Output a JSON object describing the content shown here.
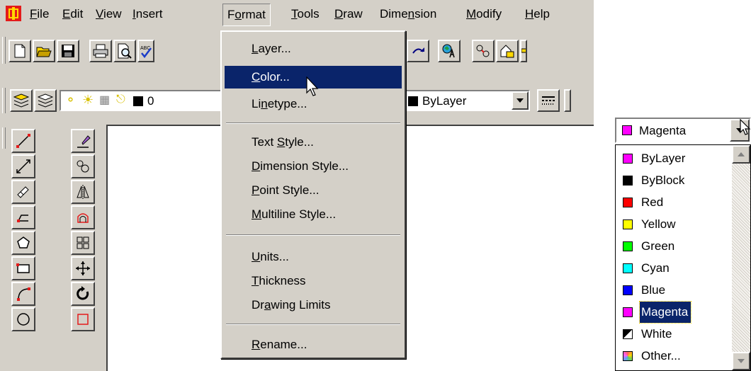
{
  "menubar": {
    "items": [
      {
        "pre": "",
        "key": "F",
        "post": "ile"
      },
      {
        "pre": "",
        "key": "E",
        "post": "dit"
      },
      {
        "pre": "",
        "key": "V",
        "post": "iew"
      },
      {
        "pre": "",
        "key": "I",
        "post": "nsert"
      },
      {
        "pre": "F",
        "key": "o",
        "post": "rmat"
      },
      {
        "pre": "",
        "key": "T",
        "post": "ools"
      },
      {
        "pre": "",
        "key": "D",
        "post": "raw"
      },
      {
        "pre": "Dime",
        "key": "n",
        "post": "sion"
      },
      {
        "pre": "",
        "key": "M",
        "post": "odify"
      },
      {
        "pre": "",
        "key": "H",
        "post": "elp"
      }
    ]
  },
  "layer_toolbar": {
    "layer_value": "0",
    "color_value": "ByLayer"
  },
  "format_menu": {
    "items": [
      {
        "pre": "",
        "key": "L",
        "post": "ayer..."
      },
      {
        "pre": "",
        "key": "C",
        "post": "olor..."
      },
      {
        "pre": "Li",
        "key": "n",
        "post": "etype..."
      },
      {
        "pre": "Text ",
        "key": "S",
        "post": "tyle..."
      },
      {
        "pre": "",
        "key": "D",
        "post": "imension Style..."
      },
      {
        "pre": "",
        "key": "P",
        "post": "oint Style..."
      },
      {
        "pre": "",
        "key": "M",
        "post": "ultiline Style..."
      },
      {
        "pre": "",
        "key": "U",
        "post": "nits..."
      },
      {
        "pre": "",
        "key": "T",
        "post": "hickness"
      },
      {
        "pre": "Dr",
        "key": "a",
        "post": "wing Limits"
      },
      {
        "pre": "",
        "key": "R",
        "post": "ename..."
      }
    ]
  },
  "color_dropdown": {
    "selected": "Magenta",
    "selected_color": "#ff00ff",
    "options": [
      {
        "label": "ByLayer",
        "color": "#ff00ff"
      },
      {
        "label": "ByBlock",
        "color": "#000000"
      },
      {
        "label": "Red",
        "color": "#ff0000"
      },
      {
        "label": "Yellow",
        "color": "#ffff00"
      },
      {
        "label": "Green",
        "color": "#00ff00"
      },
      {
        "label": "Cyan",
        "color": "#00ffff"
      },
      {
        "label": "Blue",
        "color": "#0000ff"
      },
      {
        "label": "Magenta",
        "color": "#ff00ff"
      },
      {
        "label": "White",
        "color": "#000000"
      },
      {
        "label": "Other...",
        "color": "#c8c8ff"
      }
    ]
  },
  "colors": {
    "highlight": "#0a246a",
    "face": "#d4d0c8"
  },
  "icons": [
    "app-icon",
    "new-icon",
    "open-icon",
    "save-icon",
    "print-icon",
    "preview-icon",
    "spellcheck-icon",
    "redo-icon",
    "aerial-view-icon",
    "cursor-arrow-icon"
  ]
}
